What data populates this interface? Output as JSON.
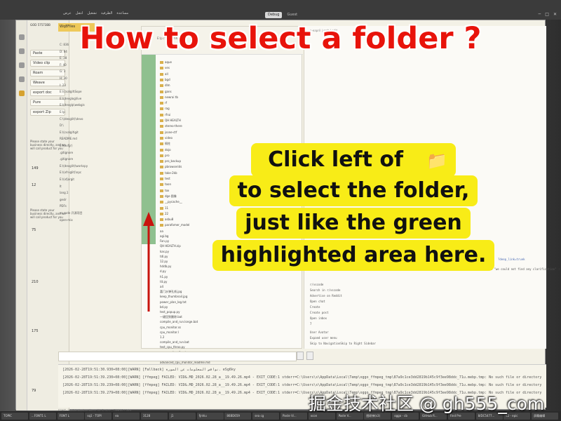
{
  "overlay": {
    "title": "How to select a folder ?",
    "callout_line1": "Click left of",
    "callout_icon": "📁",
    "callout_line2": "to select the folder,",
    "callout_line3": "just like the green",
    "callout_line4": "highlighted area here.",
    "watermark": "掘金技术社区 @ gh555_com"
  },
  "topbar": {
    "menu": [
      "عرض",
      "انتقل",
      "تشغيل",
      "الطرفية",
      "مساعدة"
    ],
    "title_tabs": [
      "Debug",
      "Guest"
    ]
  },
  "panel1": {
    "id": "GOD 57573BB",
    "buttons": [
      "Paste",
      "Video clip",
      "Roam",
      "Weave",
      "export doc",
      "Pure",
      "export Zip"
    ],
    "side_label": "Savor momen",
    "notes": [
      "Please state your business directly, and we will call product for you",
      "Please state your business directly, and we will call product for you"
    ],
    "counts": [
      "149",
      "12",
      "75",
      "210",
      "175",
      "79"
    ]
  },
  "sidebar": {
    "header": "Wq8Files",
    "rows": [
      "C: 836",
      "D: 84",
      "E: 38",
      "F: 40",
      "G: 3",
      "H: 30",
      "I: 23",
      "E:\\(cvalgit\\Sope",
      "E:\\(devglog\\live",
      "E:\\(devglp\\webgis",
      "E:\\p",
      "C:\\(devglit)\\devo",
      "D:\\",
      "E:\\(cvalgit\\git",
      "README.md",
      "E:\\(ovfjjr)",
      ".gitignore",
      ".gitignore",
      "E:\\(devglit)\\workspy",
      "E:\\(vfrvglit)\\npc",
      "E:\\(vfjorgit",
      "It",
      "lang.1",
      "gesIr",
      "PDFs",
      "vs code 开源项目",
      "open-mix"
    ]
  },
  "explorer": {
    "breadcrumb": "E:\\p / \\os \\ \\mh1 \\ list",
    "folders": [
      "aque",
      "ves",
      "all",
      "bgd",
      "dlm",
      "gans",
      "newrai tb",
      "rf",
      "rag",
      "rfrui",
      "QH HEALTH",
      "stereo-there",
      "jsone-ctf",
      "video",
      "佩柱",
      "dojo",
      "pro",
      "pro_backup",
      "pbrowserids",
      "take-2kb",
      "test",
      "toon",
      "tox",
      "dge 图像",
      "__pycache__",
      "11",
      "22",
      "asbu8",
      "parafomer_model"
    ],
    "files": [
      "aa",
      "agi.bg",
      "Fan.py",
      "QH HEALTH.zip",
      "kas.py",
      "tdl.py",
      "12.py",
      "hddb.py",
      "d.py",
      "h1.py",
      "tit.py",
      "a4",
      "喜门水弹孔线.jpg",
      "keep_thumbnail.jpg",
      "power_plan_log.txt",
      "bd.py",
      "test_popup.py",
      "一键回到删除.bat",
      "compile_and_run.longe.bat",
      "cpu_monitor.ss",
      "cpu_monitor.l",
      "1.2",
      "compile_and_run.bat",
      "test_cpu_throo.py",
      "cpu_monitor_fixed.py",
      "advanced_cpu_monitor.py",
      "advanced_cpu_monitor_readme.md"
    ]
  },
  "editor": {
    "tab": "a-eapril | srch | edit",
    "lines": [
      "Skip to main content",
      "VS Marketplace locked my extension for 7 days, ignored 5 detailed emails with full source code, then replied \"we could not find any clarification\" : r/vscode",
      "r/vscode",
      "Search in r/vscode",
      "Advertise on Reddit",
      "Open chat",
      "Create",
      "Create post",
      "Open inbox",
      "7",
      "User Avatar",
      "Expand user menu",
      "Skip to NavigationSkip to Right Sidebar"
    ],
    "link": "?deep_link=truek"
  },
  "terminal": {
    "lines": [
      "[2026-02-28T19:51:30.930+08:00][WARN] [Fallback] نواقص المعلومات عن الصورة. eSg6ky",
      "[2026-02-28T19:51:39.230+08:00][WARN] [ffmpeg] FAILED: VID&.MD_2026.02.28_a__19.49.26.mp4 - EXIT_CODE:1 stderr=C:\\Users\\s\\AppData\\Local\\Temp\\oggo_ffmpeg_tmp\\87a9c1ce3dd2819b145c9f3ee98ddc_71u.mebp.tmp: No such file or directory",
      "[2026-02-28T19:51:39.239+08:00][WARN] [ffmpeg] FAILED: VID&.MD_2026.02.28_a__19.49.26.mp4 - EXIT_CODE:1 stderr=C:\\Users\\s\\AppData\\Local\\Temp\\oggo_ffmpeg_tmp\\87a9c1ce3dd2819b145c9f3ee98ddc_71u.mebp.tmp: No such file or directory",
      "[2026-02-28T19:51:39.279+08:00][WARN] [ffmpeg] FAILED: VID&.MD_2026.02.28_a__19.49.26.mp4 - EXIT_CODE:1 stderr=C:\\Users\\s\\AppData\\Local\\Temp\\oggo_ffmpeg_tmp\\87a9c1ce3dd2819b145c9f3ee98ddc_71u.mebp.tmp: No such file or directory"
    ],
    "status": "FONT: 1.NSW Median Mono 04 Scales - FMNAR Light"
  },
  "taskbar": {
    "items": [
      "TOPIC",
      "...FONT1 L",
      "FONT L",
      "sq1 - TOPI",
      "ea",
      "3128",
      "j1",
      "fjnhiu",
      "86BD659",
      "sea cg",
      "Paste Vi...",
      "xcon",
      "Paste V...",
      "图研神(s3)",
      "oggo - cb",
      "GitHub R...",
      "Find Pre",
      "8/DC5477...",
      "c2 - epic",
      "屏幕编辑"
    ]
  },
  "colors": {
    "title_red": "#e8130b",
    "callout_yellow": "#f8ec17",
    "highlight_green": "#8fc08f",
    "folder_header": "#eec95a",
    "arrow_red": "#c8140e"
  }
}
